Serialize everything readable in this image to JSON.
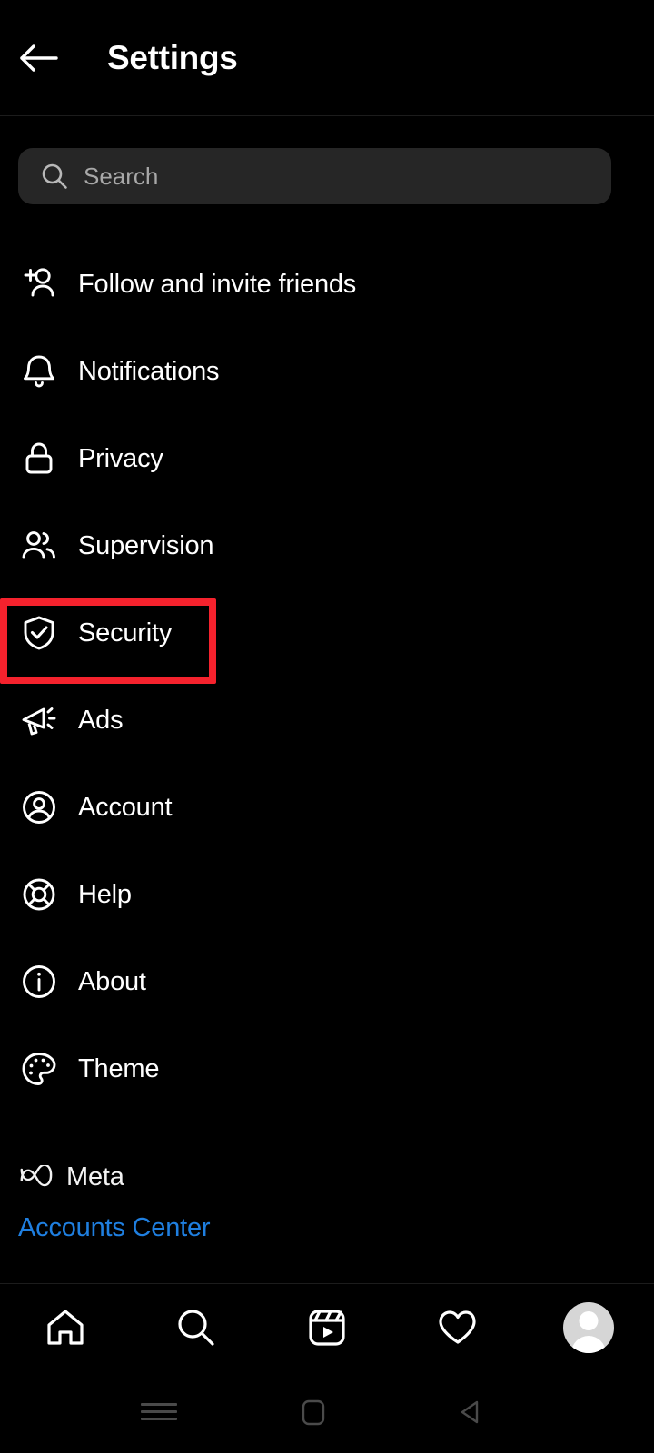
{
  "header": {
    "title": "Settings",
    "back_icon": "arrow-left-icon"
  },
  "search": {
    "placeholder": "Search",
    "value": "",
    "icon": "search-icon"
  },
  "menu": {
    "items": [
      {
        "label": "Follow and invite friends",
        "icon": "person-add-icon",
        "highlighted": false
      },
      {
        "label": "Notifications",
        "icon": "bell-icon",
        "highlighted": false
      },
      {
        "label": "Privacy",
        "icon": "lock-icon",
        "highlighted": false
      },
      {
        "label": "Supervision",
        "icon": "people-icon",
        "highlighted": false
      },
      {
        "label": "Security",
        "icon": "shield-check-icon",
        "highlighted": true
      },
      {
        "label": "Ads",
        "icon": "megaphone-icon",
        "highlighted": false
      },
      {
        "label": "Account",
        "icon": "account-circle-icon",
        "highlighted": false
      },
      {
        "label": "Help",
        "icon": "life-ring-icon",
        "highlighted": false
      },
      {
        "label": "About",
        "icon": "info-circle-icon",
        "highlighted": false
      },
      {
        "label": "Theme",
        "icon": "palette-icon",
        "highlighted": false
      }
    ]
  },
  "meta": {
    "brand": "Meta",
    "logo_icon": "meta-infinity-icon",
    "accounts_center": "Accounts Center"
  },
  "tabbar": {
    "items": [
      {
        "name": "home-tab",
        "icon": "home-icon"
      },
      {
        "name": "search-tab",
        "icon": "search-icon"
      },
      {
        "name": "reels-tab",
        "icon": "reels-icon"
      },
      {
        "name": "activity-tab",
        "icon": "heart-icon"
      },
      {
        "name": "profile-tab",
        "icon": "avatar-icon"
      }
    ]
  },
  "android_nav": {
    "items": [
      {
        "name": "recents-button",
        "icon": "hamburger-icon"
      },
      {
        "name": "home-button",
        "icon": "rounded-square-icon"
      },
      {
        "name": "back-button",
        "icon": "triangle-left-icon"
      }
    ]
  },
  "colors": {
    "background": "#000000",
    "surface": "#262626",
    "text_primary": "#ffffff",
    "text_placeholder": "#a8a8a8",
    "link": "#1f7fe0",
    "highlight": "#f5222d",
    "divider": "#1c1c1c"
  }
}
